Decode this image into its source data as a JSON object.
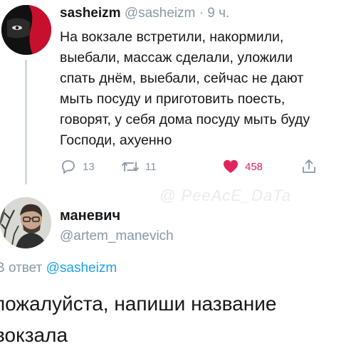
{
  "tweet": {
    "display_name": "sasheizm",
    "handle": "@sasheizm",
    "separator": "·",
    "time": "9 ч.",
    "text_lines": [
      "На вокзале встретили, накормили,",
      "выебали, массаж сделали, уложили",
      "спать днём, выебали, сейчас не дают",
      "мыть посуду и приготовить поесть,",
      "говорят, у себя дома посуду мыть буду",
      "Господи, ахуенно"
    ],
    "actions": {
      "reply_count": "13",
      "retweet_count": "11",
      "like_count": "458"
    },
    "colors": {
      "like_active": "#e0245e",
      "muted": "#8899a6",
      "link": "#1da1f2"
    },
    "icons": [
      "reply-icon",
      "retweet-icon",
      "heart-icon",
      "share-icon"
    ]
  },
  "watermark": "@ PeeAcE_DaTa",
  "reply": {
    "display_name": "маневич",
    "handle": "@artem_manevich",
    "reply_prefix": "В ответ",
    "reply_target": "@sasheizm",
    "text_lines": [
      "пожалуйста, напиши название",
      "вокзала"
    ]
  }
}
